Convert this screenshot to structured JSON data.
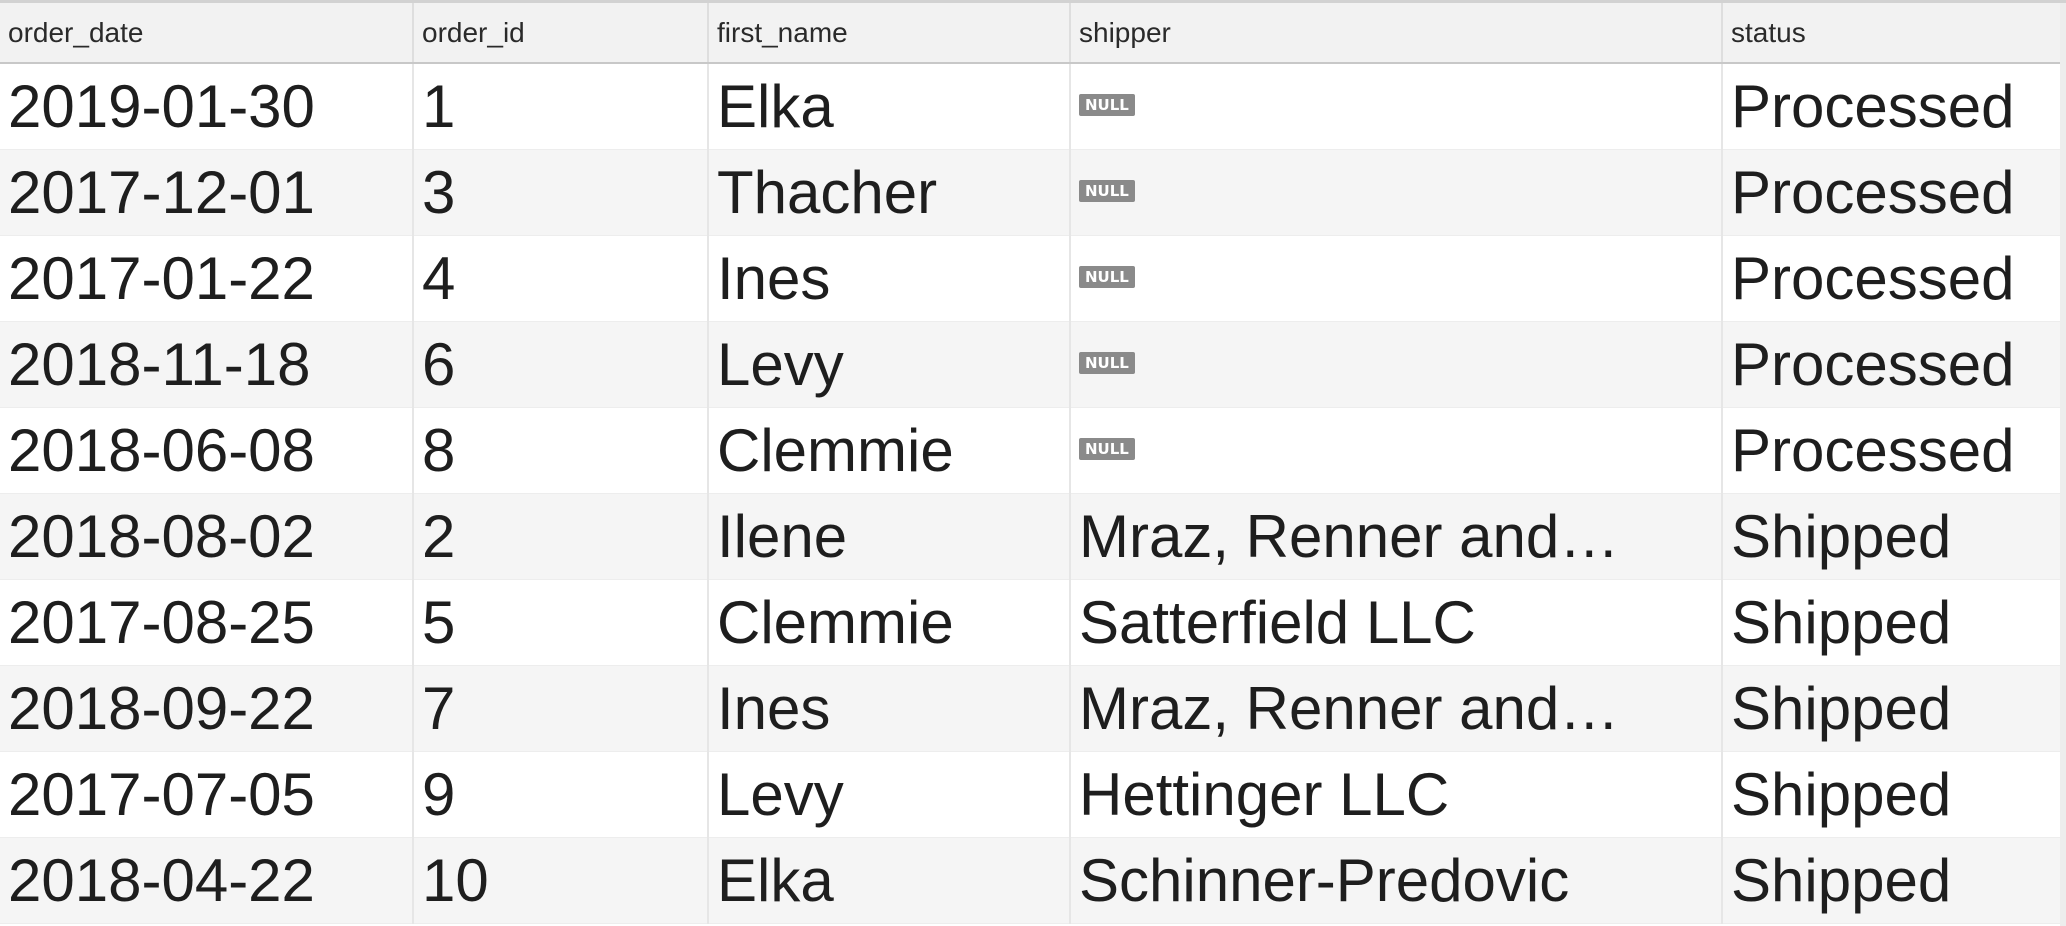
{
  "table": {
    "columns": [
      "order_date",
      "order_id",
      "first_name",
      "shipper",
      "status"
    ],
    "null_label": "NULL",
    "rows": [
      {
        "order_date": "2019-01-30",
        "order_id": "1",
        "first_name": "Elka",
        "shipper": null,
        "status": "Processed"
      },
      {
        "order_date": "2017-12-01",
        "order_id": "3",
        "first_name": "Thacher",
        "shipper": null,
        "status": "Processed"
      },
      {
        "order_date": "2017-01-22",
        "order_id": "4",
        "first_name": "Ines",
        "shipper": null,
        "status": "Processed"
      },
      {
        "order_date": "2018-11-18",
        "order_id": "6",
        "first_name": "Levy",
        "shipper": null,
        "status": "Processed"
      },
      {
        "order_date": "2018-06-08",
        "order_id": "8",
        "first_name": "Clemmie",
        "shipper": null,
        "status": "Processed"
      },
      {
        "order_date": "2018-08-02",
        "order_id": "2",
        "first_name": "Ilene",
        "shipper": "Mraz, Renner and…",
        "status": "Shipped"
      },
      {
        "order_date": "2017-08-25",
        "order_id": "5",
        "first_name": "Clemmie",
        "shipper": "Satterfield LLC",
        "status": "Shipped"
      },
      {
        "order_date": "2018-09-22",
        "order_id": "7",
        "first_name": "Ines",
        "shipper": "Mraz, Renner and…",
        "status": "Shipped"
      },
      {
        "order_date": "2017-07-05",
        "order_id": "9",
        "first_name": "Levy",
        "shipper": "Hettinger LLC",
        "status": "Shipped"
      },
      {
        "order_date": "2018-04-22",
        "order_id": "10",
        "first_name": "Elka",
        "shipper": "Schinner-Predovic",
        "status": "Shipped"
      }
    ]
  }
}
